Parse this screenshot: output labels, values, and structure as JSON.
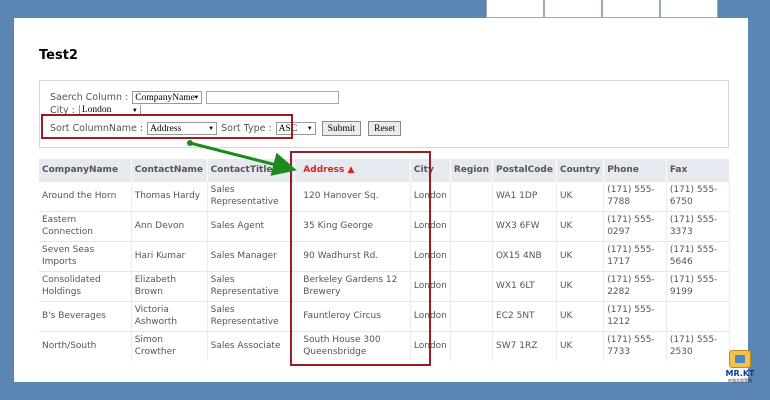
{
  "page": {
    "title": "Test2"
  },
  "search": {
    "column_label": "Saerch Column :",
    "column_value": "CompanyName",
    "text_value": "",
    "city_label": "City :",
    "city_value": "London",
    "sort_column_label": "Sort ColumnName :",
    "sort_column_value": "Address",
    "sort_type_label": "Sort Type :",
    "sort_type_value": "ASC",
    "submit_label": "Submit",
    "reset_label": "Reset"
  },
  "grid": {
    "headers": [
      "CompanyName",
      "ContactName",
      "ContactTitle",
      "Address ▲",
      "City",
      "Region",
      "PostalCode",
      "Country",
      "Phone",
      "Fax"
    ],
    "rows": [
      [
        "Around the Horn",
        "Thomas Hardy",
        "Sales Representative",
        "120 Hanover Sq.",
        "London",
        "",
        "WA1 1DP",
        "UK",
        "(171) 555-7788",
        "(171) 555-6750"
      ],
      [
        "Eastern Connection",
        "Ann Devon",
        "Sales Agent",
        "35 King George",
        "London",
        "",
        "WX3 6FW",
        "UK",
        "(171) 555-0297",
        "(171) 555-3373"
      ],
      [
        "Seven Seas Imports",
        "Hari Kumar",
        "Sales Manager",
        "90 Wadhurst Rd.",
        "London",
        "",
        "OX15 4NB",
        "UK",
        "(171) 555-1717",
        "(171) 555-5646"
      ],
      [
        "Consolidated Holdings",
        "Elizabeth Brown",
        "Sales Representative",
        "Berkeley Gardens 12 Brewery",
        "London",
        "",
        "WX1 6LT",
        "UK",
        "(171) 555-2282",
        "(171) 555-9199"
      ],
      [
        "B's Beverages",
        "Victoria Ashworth",
        "Sales Representative",
        "Fauntleroy Circus",
        "London",
        "",
        "EC2 5NT",
        "UK",
        "(171) 555-1212",
        ""
      ],
      [
        "North/South",
        "Simon Crowther",
        "Sales Associate",
        "South House 300 Queensbridge",
        "London",
        "",
        "SW7 1RZ",
        "UK",
        "(171) 555-7733",
        "(171) 555-2530"
      ]
    ]
  },
  "logo": {
    "name": "MR.KT",
    "tagline": "的強式部落格"
  },
  "colors": {
    "frame": "#5b86b4",
    "highlight": "#9b1c25",
    "arrow": "#1e8a1e",
    "active_header": "#e0201a"
  }
}
